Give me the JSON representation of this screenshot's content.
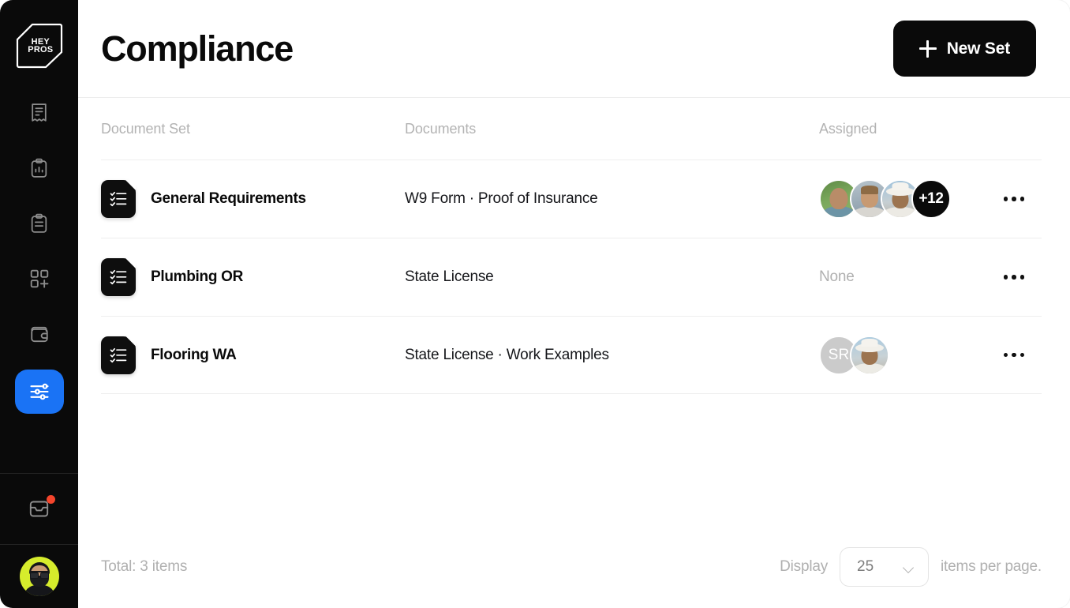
{
  "app": {
    "logo_text": "HEY\nPROS",
    "accent_color": "#1a73f5",
    "sidebar_bg": "#0a0a0a"
  },
  "sidebar": {
    "items": [
      {
        "icon": "receipt-icon",
        "name": "sidebar-item-invoices",
        "active": false
      },
      {
        "icon": "clipboard-chart-icon",
        "name": "sidebar-item-reports",
        "active": false
      },
      {
        "icon": "clipboard-list-icon",
        "name": "sidebar-item-jobs",
        "active": false
      },
      {
        "icon": "grid-plus-icon",
        "name": "sidebar-item-add-module",
        "active": false
      },
      {
        "icon": "wallet-icon",
        "name": "sidebar-item-payments",
        "active": false
      },
      {
        "icon": "sliders-icon",
        "name": "sidebar-item-compliance",
        "active": true
      }
    ],
    "inbox": {
      "icon": "inbox-icon",
      "has_notification": true,
      "badge_color": "#f4452c"
    },
    "profile": {
      "icon": "avatar",
      "bg_color": "#d6ec2c"
    }
  },
  "header": {
    "title": "Compliance",
    "new_set_label": "New Set",
    "new_set_icon": "plus-icon"
  },
  "table": {
    "columns": [
      "Document Set",
      "Documents",
      "Assigned"
    ],
    "rows": [
      {
        "icon": "checklist-document-icon",
        "name": "General Requirements",
        "documents": [
          "W9 Form",
          "Proof of Insurance"
        ],
        "assigned_type": "avatars",
        "assigned_count_label": "+12",
        "assigned_avatars": 3,
        "menu_icon": "more-horizontal-icon"
      },
      {
        "icon": "checklist-document-icon",
        "name": "Plumbing OR",
        "documents": [
          "State License"
        ],
        "assigned_type": "none",
        "assigned_none_label": "None",
        "menu_icon": "more-horizontal-icon"
      },
      {
        "icon": "checklist-document-icon",
        "name": "Flooring WA",
        "documents": [
          "State License",
          "Work Examples"
        ],
        "assigned_type": "avatars",
        "assigned_initials": "SR",
        "assigned_avatars": 1,
        "menu_icon": "more-horizontal-icon"
      }
    ],
    "separator": "·"
  },
  "footer": {
    "total_label": "Total: 3 items",
    "display_label": "Display",
    "page_size": "25",
    "items_per_page_label": "items per page.",
    "chevron_icon": "chevron-down-icon"
  }
}
